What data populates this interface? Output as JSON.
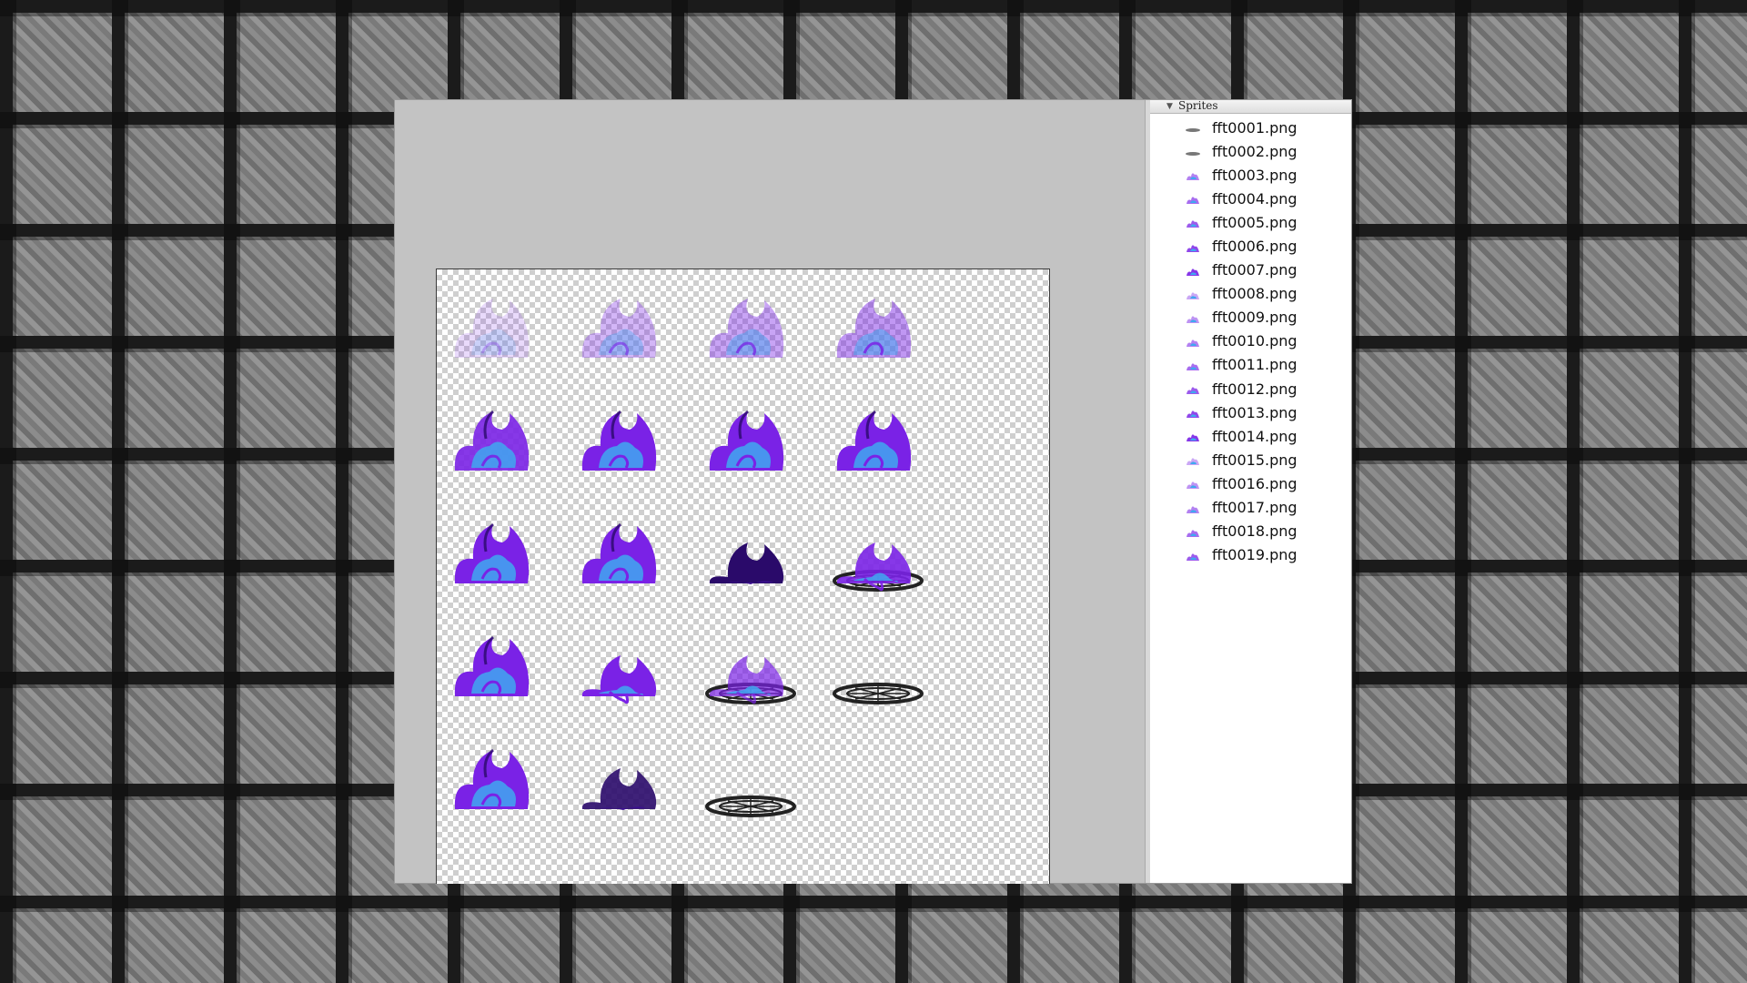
{
  "panel": {
    "title": "Sprites",
    "items": [
      {
        "label": "fft0001.png",
        "thumb": "disc-thumb"
      },
      {
        "label": "fft0002.png",
        "thumb": "disc-thumb"
      },
      {
        "label": "fft0003.png",
        "thumb": "flame-thumb"
      },
      {
        "label": "fft0004.png",
        "thumb": "flame-thumb"
      },
      {
        "label": "fft0005.png",
        "thumb": "flame-thumb"
      },
      {
        "label": "fft0006.png",
        "thumb": "flame-thumb"
      },
      {
        "label": "fft0007.png",
        "thumb": "flame-thumb"
      },
      {
        "label": "fft0008.png",
        "thumb": "flame-thumb"
      },
      {
        "label": "fft0009.png",
        "thumb": "flame-thumb"
      },
      {
        "label": "fft0010.png",
        "thumb": "flame-thumb"
      },
      {
        "label": "fft0011.png",
        "thumb": "flame-thumb"
      },
      {
        "label": "fft0012.png",
        "thumb": "flame-thumb"
      },
      {
        "label": "fft0013.png",
        "thumb": "flame-thumb"
      },
      {
        "label": "fft0014.png",
        "thumb": "flame-thumb"
      },
      {
        "label": "fft0015.png",
        "thumb": "flame-thumb"
      },
      {
        "label": "fft0016.png",
        "thumb": "flame-thumb"
      },
      {
        "label": "fft0017.png",
        "thumb": "flame-thumb"
      },
      {
        "label": "fft0018.png",
        "thumb": "flame-thumb"
      },
      {
        "label": "fft0019.png",
        "thumb": "flame-thumb"
      }
    ]
  },
  "sprite_sheet": {
    "frames": [
      {
        "kind": "wisp",
        "strength": 0.3
      },
      {
        "kind": "wisp",
        "strength": 0.6
      },
      {
        "kind": "wisp",
        "strength": 0.75
      },
      {
        "kind": "wisp",
        "strength": 0.85
      },
      {
        "kind": "flame",
        "strength": 0.9
      },
      {
        "kind": "flame",
        "strength": 1.0
      },
      {
        "kind": "flame",
        "strength": 1.0
      },
      {
        "kind": "flame",
        "strength": 1.0
      },
      {
        "kind": "flame",
        "strength": 1.0
      },
      {
        "kind": "flame",
        "strength": 1.0
      },
      {
        "kind": "dark-flame",
        "strength": 1.0
      },
      {
        "kind": "flame-ring",
        "strength": 0.9
      },
      {
        "kind": "flame",
        "strength": 1.0
      },
      {
        "kind": "flame-small",
        "strength": 1.0
      },
      {
        "kind": "flame-ring",
        "strength": 0.7
      },
      {
        "kind": "ring",
        "strength": 1.0
      },
      {
        "kind": "flame",
        "strength": 1.0
      },
      {
        "kind": "dark-flame",
        "strength": 0.9
      },
      {
        "kind": "ring",
        "strength": 1.0
      }
    ],
    "colors": {
      "purple": "#7a22e6",
      "blue": "#3fa8f0",
      "dark": "#2a0a6a",
      "ring": "#222222"
    }
  }
}
